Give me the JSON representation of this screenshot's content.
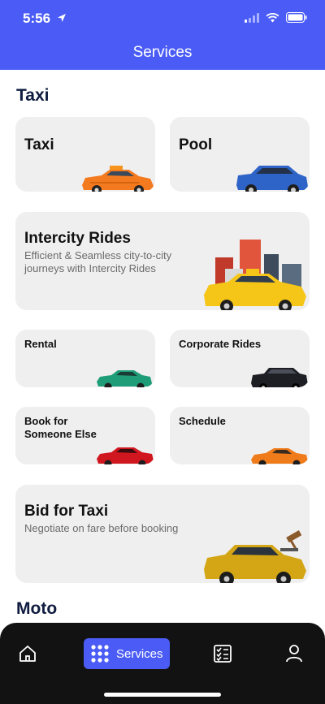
{
  "status": {
    "time": "5:56"
  },
  "header": {
    "title": "Services"
  },
  "sections": [
    {
      "title": "Taxi"
    },
    {
      "title": "Moto"
    }
  ],
  "cards": {
    "taxi": {
      "title": "Taxi"
    },
    "pool": {
      "title": "Pool"
    },
    "intercity": {
      "title": "Intercity Rides",
      "subtitle": "Efficient & Seamless city-to-city journeys with Intercity Rides"
    },
    "rental": {
      "title": "Rental"
    },
    "corporate": {
      "title": "Corporate Rides"
    },
    "book_for": {
      "title": "Book for Someone Else"
    },
    "schedule": {
      "title": "Schedule"
    },
    "bid": {
      "title": "Bid for Taxi",
      "subtitle": "Negotiate on fare before booking"
    }
  },
  "nav": {
    "active_label": "Services",
    "items": [
      "home-icon",
      "services-grid-icon",
      "checklist-icon",
      "profile-icon"
    ]
  },
  "colors": {
    "accent": "#4a5cf5",
    "card_bg": "#efefef",
    "nav_bg": "#121212"
  }
}
